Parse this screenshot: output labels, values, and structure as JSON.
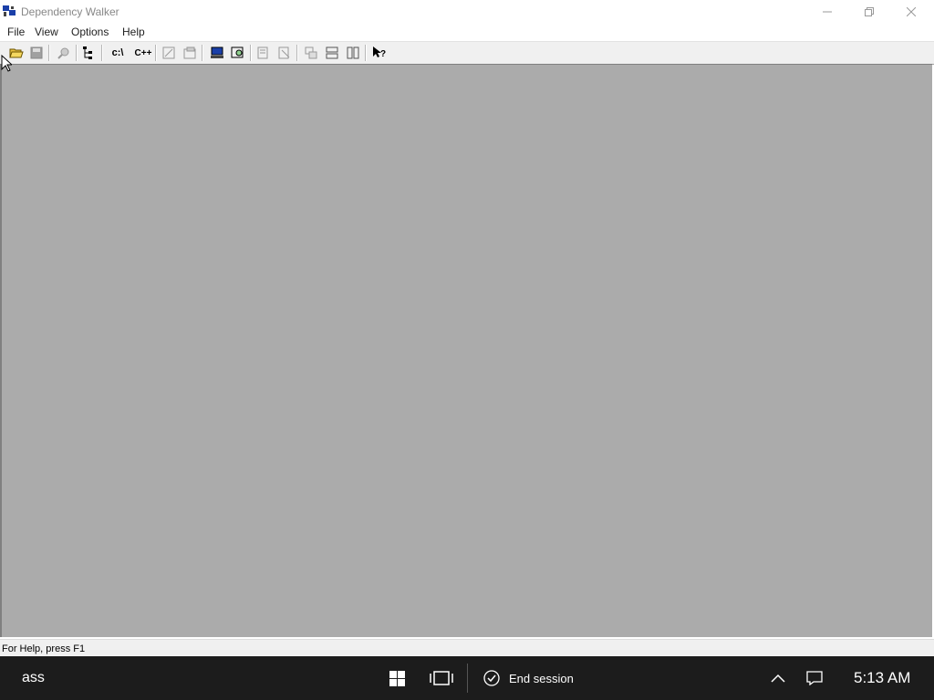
{
  "window": {
    "title": "Dependency Walker",
    "menu": [
      "File",
      "View",
      "Options",
      "Help"
    ]
  },
  "toolbar": {
    "drive_label": "c:\\",
    "cpp_label": "C++"
  },
  "status": {
    "text": "For Help, press F1"
  },
  "taskbar": {
    "left_text": "ass",
    "end_session": "End session",
    "clock": "5:13 AM"
  },
  "colors": {
    "client_bg": "#ababab",
    "taskbar_bg": "#1c1c1c"
  },
  "icons": [
    "open-icon",
    "save-icon",
    "find-icon",
    "tree-icon",
    "c-drive-icon",
    "cpp-icon",
    "view-icon",
    "properties-icon",
    "system-info-icon",
    "zoom-icon",
    "expand-icon",
    "collapse-icon",
    "cascade-icon",
    "tile-horizontal-icon",
    "tile-vertical-icon",
    "context-help-icon"
  ]
}
